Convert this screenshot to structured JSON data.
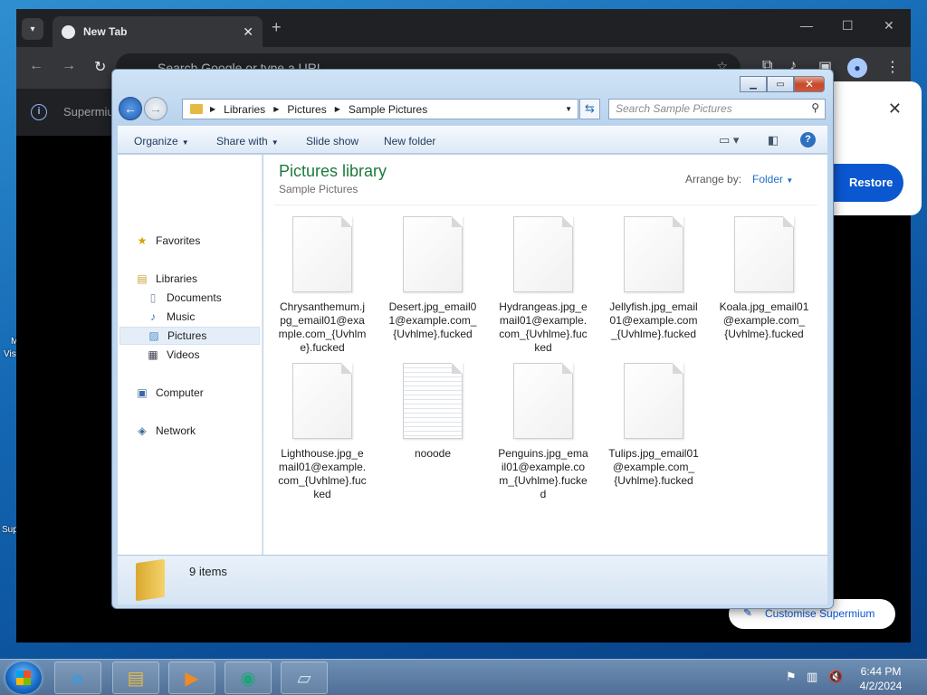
{
  "desktop": {
    "edge_labels": [
      "M",
      "Vis",
      "Sup"
    ]
  },
  "browser": {
    "tab_title": "New Tab",
    "new_tab": "+",
    "omnibox_placeholder": "Search Google or type a URL",
    "infobar_text": "Supermium",
    "popup_close": "✕",
    "restore_label": "Restore",
    "customise_label": "Customise Supermium"
  },
  "explorer": {
    "breadcrumb": [
      "Libraries",
      "Pictures",
      "Sample Pictures"
    ],
    "search_placeholder": "Search Sample Pictures",
    "commands": {
      "organize": "Organize",
      "share": "Share with",
      "slideshow": "Slide show",
      "new_folder": "New folder"
    },
    "nav": {
      "favorites": "Favorites",
      "libraries": "Libraries",
      "documents": "Documents",
      "music": "Music",
      "pictures": "Pictures",
      "videos": "Videos",
      "computer": "Computer",
      "network": "Network"
    },
    "library_title": "Pictures library",
    "library_subtitle": "Sample Pictures",
    "arrange_label": "Arrange by:",
    "arrange_value": "Folder",
    "files": [
      "Chrysanthemum.jpg_email01@example.com_{Uvhlme}.fucked",
      "Desert.jpg_email01@example.com_{Uvhlme}.fucked",
      "Hydrangeas.jpg_email01@example.com_{Uvhlme}.fucked",
      "Jellyfish.jpg_email01@example.com_{Uvhlme}.fucked",
      "Koala.jpg_email01@example.com_{Uvhlme}.fucked",
      "Lighthouse.jpg_email01@example.com_{Uvhlme}.fucked",
      "nooode",
      "Penguins.jpg_email01@example.com_{Uvhlme}.fucked",
      "Tulips.jpg_email01@example.com_{Uvhlme}.fucked"
    ],
    "item_count": "9 items"
  },
  "taskbar": {
    "time": "6:44 PM",
    "date": "4/2/2024"
  }
}
